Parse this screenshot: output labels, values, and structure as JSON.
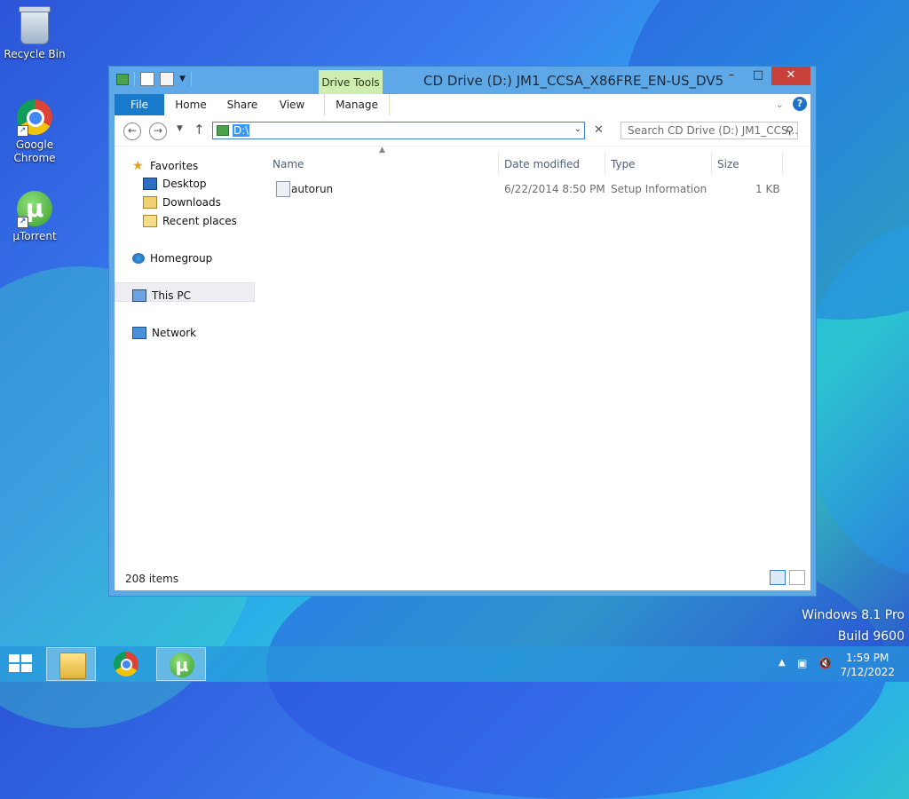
{
  "desktop": {
    "icons": [
      {
        "label": "Recycle Bin"
      },
      {
        "label": "Google Chrome"
      },
      {
        "label": "µTorrent"
      }
    ],
    "watermark": {
      "line1": "Windows 8.1 Pro",
      "line2": "Build 9600"
    }
  },
  "window": {
    "title": "CD Drive (D:) JM1_CCSA_X86FRE_EN-US_DV5",
    "contextual_tab": "Drive Tools",
    "controls": {
      "minimize": "–",
      "maximize": "□",
      "close": "✕"
    },
    "ribbon_tabs": [
      "File",
      "Home",
      "Share",
      "View",
      "Manage"
    ],
    "address": {
      "value": "D:\\"
    },
    "search": {
      "placeholder": "Search CD Drive (D:) JM1_CCS..."
    },
    "nav_pane": {
      "favorites": "Favorites",
      "favorites_items": [
        "Desktop",
        "Downloads",
        "Recent places"
      ],
      "homegroup": "Homegroup",
      "this_pc": "This PC",
      "network": "Network"
    },
    "columns": [
      "Name",
      "Date modified",
      "Type",
      "Size"
    ],
    "files": [
      {
        "name": "autorun",
        "date": "6/22/2014 8:50 PM",
        "type": "Setup Information",
        "size": "1 KB"
      }
    ],
    "status": "208 items"
  },
  "taskbar": {
    "apps": [
      "file-explorer",
      "google-chrome",
      "utorrent"
    ],
    "clock": {
      "time": "1:59 PM",
      "date": "7/12/2022"
    }
  }
}
